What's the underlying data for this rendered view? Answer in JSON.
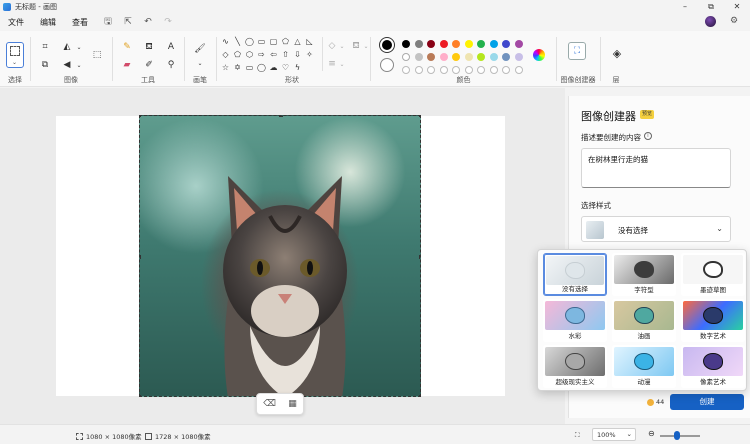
{
  "window": {
    "title": "无标题 - 画图"
  },
  "menu": {
    "file": "文件",
    "edit": "编辑",
    "view": "查看"
  },
  "ribbon": {
    "groups": {
      "select": "选择",
      "image": "图像",
      "tools": "工具",
      "brushes": "画笔",
      "shapes": "形状",
      "colors": "颜色",
      "image_creator": "图像创建器",
      "layers": "层"
    },
    "palette_row1": [
      "#000000",
      "#7f7f7f",
      "#880015",
      "#ed1c24",
      "#ff7f27",
      "#fff200",
      "#22b14c",
      "#00a2e8",
      "#3f48cc",
      "#a349a4"
    ],
    "palette_row2": [
      "#ffffff",
      "#c3c3c3",
      "#b97a57",
      "#ffaec9",
      "#ffc90e",
      "#efe4b0",
      "#b5e61d",
      "#99d9ea",
      "#7092be",
      "#c8bfe7"
    ],
    "primary_color": "#000000",
    "secondary_color": "#ffffff"
  },
  "panel": {
    "title": "图像创建器",
    "badge": "预览",
    "prompt_label": "描述要创建的内容",
    "prompt_value": "在树林里行走的猫",
    "style_label": "选择样式",
    "style_value": "没有选择",
    "credits": "44",
    "create_label": "创建"
  },
  "styles": [
    {
      "label": "没有选择",
      "selected": true
    },
    {
      "label": "字符型",
      "selected": false
    },
    {
      "label": "墨迹草图",
      "selected": false
    },
    {
      "label": "水彩",
      "selected": false
    },
    {
      "label": "油画",
      "selected": false
    },
    {
      "label": "数字艺术",
      "selected": false
    },
    {
      "label": "超级现实主义",
      "selected": false
    },
    {
      "label": "动漫",
      "selected": false
    },
    {
      "label": "像素艺术",
      "selected": false
    }
  ],
  "status": {
    "selection_size": "1080 × 1080像素",
    "canvas_size": "1728 × 1080像素",
    "zoom": "100%"
  }
}
